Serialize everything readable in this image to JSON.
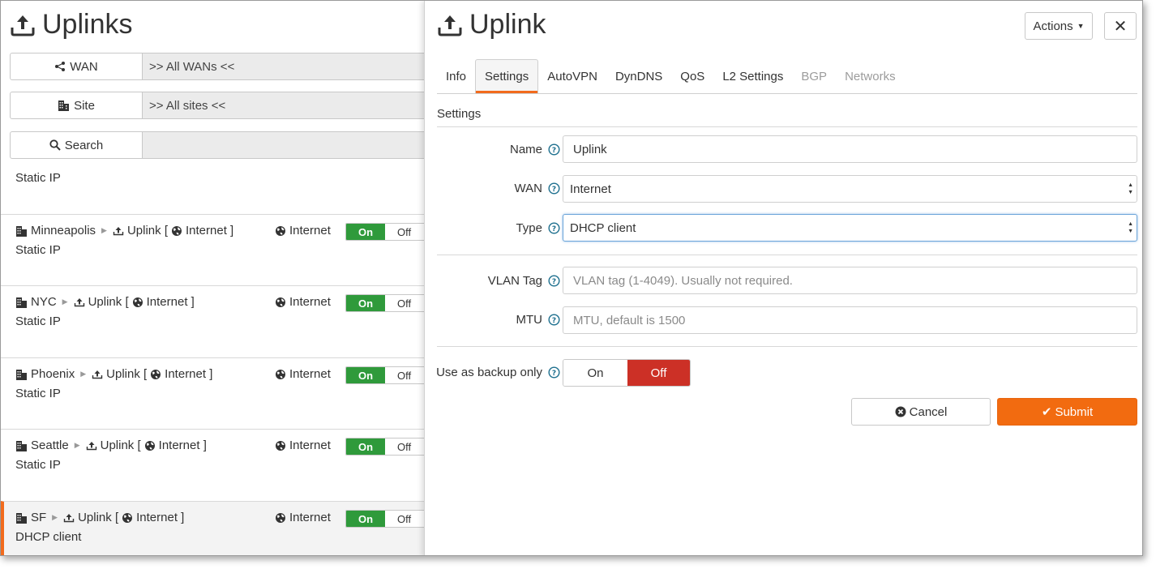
{
  "left": {
    "title": "Uplinks",
    "filters": [
      {
        "label": "WAN",
        "value": ">> All WANs <<"
      },
      {
        "label": "Site",
        "value": ">> All sites <<"
      },
      {
        "label": "Search",
        "value": ""
      }
    ],
    "top_partial_type": "Static IP",
    "items": [
      {
        "site": "Minneapolis",
        "uplink": "Uplink [",
        "wan": "Internet ]",
        "wan_name": "Internet",
        "on": "On",
        "off": "Off",
        "type": "Static IP"
      },
      {
        "site": "NYC",
        "uplink": "Uplink [",
        "wan": "Internet ]",
        "wan_name": "Internet",
        "on": "On",
        "off": "Off",
        "type": "Static IP"
      },
      {
        "site": "Phoenix",
        "uplink": "Uplink [",
        "wan": "Internet ]",
        "wan_name": "Internet",
        "on": "On",
        "off": "Off",
        "type": "Static IP"
      },
      {
        "site": "Seattle",
        "uplink": "Uplink [",
        "wan": "Internet ]",
        "wan_name": "Internet",
        "on": "On",
        "off": "Off",
        "type": "Static IP"
      },
      {
        "site": "SF",
        "uplink": "Uplink [",
        "wan": "Internet ]",
        "wan_name": "Internet",
        "on": "On",
        "off": "Off",
        "type": "DHCP client"
      }
    ]
  },
  "right": {
    "title": "Uplink",
    "actions_label": "Actions",
    "close_label": "✕",
    "tabs": [
      "Info",
      "Settings",
      "AutoVPN",
      "DynDNS",
      "QoS",
      "L2 Settings",
      "BGP",
      "Networks"
    ],
    "section_title": "Settings",
    "form": {
      "name_label": "Name",
      "name_value": "Uplink",
      "wan_label": "WAN",
      "wan_value": "Internet",
      "type_label": "Type",
      "type_value": "DHCP client",
      "vlan_label": "VLAN Tag",
      "vlan_placeholder": "VLAN tag (1-4049). Usually not required.",
      "mtu_label": "MTU",
      "mtu_placeholder": "MTU, default is 1500",
      "backup_label": "Use as backup only",
      "backup_on": "On",
      "backup_off": "Off"
    },
    "cancel_label": "Cancel",
    "submit_label": "Submit"
  },
  "colors": {
    "accent_orange": "#f26b10",
    "on_green": "#2f9a3b",
    "off_red": "#cc3026"
  }
}
